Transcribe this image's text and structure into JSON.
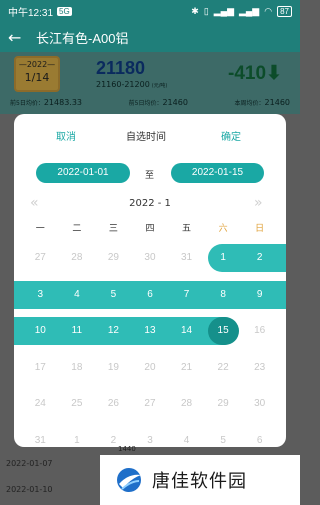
{
  "status_bar": {
    "carrier": "中午",
    "time": "12:31",
    "sim": "5G",
    "battery": "87"
  },
  "header": {
    "title": "长江有色-A00铝"
  },
  "info_card": {
    "badge_year": "—2022—",
    "badge_date": "1/14",
    "price": "21180",
    "range": "21160-21200",
    "range_unit": "(元/吨)",
    "change": "-410⬇",
    "stats": [
      {
        "label": "前5日均价：",
        "value": "21483.33"
      },
      {
        "label": "前5日均价：",
        "value": "21460"
      },
      {
        "label": "本周均价：",
        "value": "21460"
      }
    ]
  },
  "modal": {
    "cancel": "取消",
    "title": "自选时间",
    "confirm": "确定",
    "start_date": "2022-01-01",
    "to": "至",
    "end_date": "2022-01-15",
    "month": "2022 - 1",
    "weekdays": [
      "一",
      "二",
      "三",
      "四",
      "五",
      "六",
      "日"
    ],
    "weeks": [
      [
        {
          "d": "27",
          "s": "out"
        },
        {
          "d": "28",
          "s": "out"
        },
        {
          "d": "29",
          "s": "out"
        },
        {
          "d": "30",
          "s": "out"
        },
        {
          "d": "31",
          "s": "out"
        },
        {
          "d": "1",
          "s": "start"
        },
        {
          "d": "2",
          "s": "in"
        }
      ],
      [
        {
          "d": "3",
          "s": "in"
        },
        {
          "d": "4",
          "s": "in"
        },
        {
          "d": "5",
          "s": "in"
        },
        {
          "d": "6",
          "s": "in"
        },
        {
          "d": "7",
          "s": "in"
        },
        {
          "d": "8",
          "s": "in"
        },
        {
          "d": "9",
          "s": "in"
        }
      ],
      [
        {
          "d": "10",
          "s": "in"
        },
        {
          "d": "11",
          "s": "in"
        },
        {
          "d": "12",
          "s": "in"
        },
        {
          "d": "13",
          "s": "in"
        },
        {
          "d": "14",
          "s": "in"
        },
        {
          "d": "15",
          "s": "end"
        },
        {
          "d": "16",
          "s": "out"
        }
      ],
      [
        {
          "d": "17",
          "s": "out"
        },
        {
          "d": "18",
          "s": "out"
        },
        {
          "d": "19",
          "s": "out"
        },
        {
          "d": "20",
          "s": "out"
        },
        {
          "d": "21",
          "s": "out"
        },
        {
          "d": "22",
          "s": "out"
        },
        {
          "d": "23",
          "s": "out"
        }
      ],
      [
        {
          "d": "24",
          "s": "out"
        },
        {
          "d": "25",
          "s": "out"
        },
        {
          "d": "26",
          "s": "out"
        },
        {
          "d": "27",
          "s": "out"
        },
        {
          "d": "28",
          "s": "out"
        },
        {
          "d": "29",
          "s": "out"
        },
        {
          "d": "30",
          "s": "out"
        }
      ],
      [
        {
          "d": "31",
          "s": "out"
        },
        {
          "d": "1",
          "s": "out"
        },
        {
          "d": "2",
          "s": "out"
        },
        {
          "d": "3",
          "s": "out"
        },
        {
          "d": "4",
          "s": "out"
        },
        {
          "d": "5",
          "s": "out"
        },
        {
          "d": "6",
          "s": "out"
        }
      ]
    ]
  },
  "background_list": {
    "rows": [
      "2022-01-07",
      "2022-01-10"
    ],
    "faded_value": "1440"
  },
  "watermark": {
    "text": "唐佳软件园"
  },
  "colors": {
    "accent": "#1aa8a4",
    "range_band": "#2fbcb6",
    "range_end": "#15908b",
    "header": "#1f7f7a",
    "weekend": "#e0a23a"
  }
}
